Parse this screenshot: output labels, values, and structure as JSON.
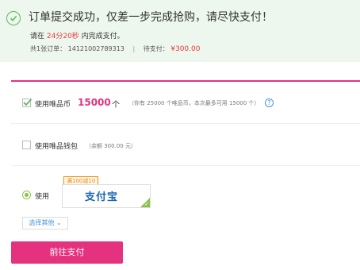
{
  "banner": {
    "title": "订单提交成功，仅差一步完成抢购，请尽快支付！",
    "countdown_prefix": "请在",
    "countdown": "24分20秒",
    "countdown_suffix": "内完成支付。",
    "order_count_label": "共1张订单：",
    "order_id": "14121002789313",
    "pending_label": "待支付：",
    "amount": "¥300.00"
  },
  "coins": {
    "label": "使用唯品币",
    "value": "15000",
    "unit": "个",
    "hint": "（你有 25000 个唯品币，本次最多可用 15000 个）",
    "help": "?",
    "checked": true
  },
  "wallet": {
    "label": "使用唯品钱包",
    "hint": "（余额 300.00 元）",
    "checked": false
  },
  "payment": {
    "label": "使用",
    "promo": "满100减10",
    "method": "支付宝",
    "more": "选择其他"
  },
  "submit": {
    "label": "前往支付"
  },
  "colors": {
    "accent": "#e4327e",
    "success": "#5cb85c",
    "price": "#e4393c",
    "link": "#4a90d9"
  }
}
